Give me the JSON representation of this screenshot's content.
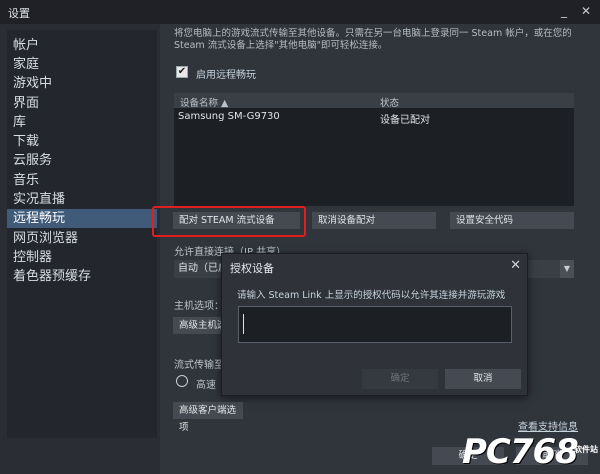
{
  "window": {
    "title": "设置",
    "minimize": "_",
    "close": "✕"
  },
  "sidebar": {
    "items": [
      {
        "label": "帐户"
      },
      {
        "label": "家庭"
      },
      {
        "label": "游戏中"
      },
      {
        "label": "界面"
      },
      {
        "label": "库"
      },
      {
        "label": "下载"
      },
      {
        "label": "云服务"
      },
      {
        "label": "音乐"
      },
      {
        "label": "实况直播"
      },
      {
        "label": "远程畅玩"
      },
      {
        "label": "网页浏览器"
      },
      {
        "label": "控制器"
      },
      {
        "label": "着色器预缓存"
      }
    ],
    "active_index": 9
  },
  "main": {
    "intro": "将您电脑上的游戏流式传输至其他设备。只需在另一台电脑上登录同一 Steam 帐户，或在您的 Steam 流式设备上选择\"其他电脑\"即可轻松连接。",
    "enable_label": "启用远程畅玩",
    "enable_checked": "✔",
    "table": {
      "headers": {
        "name": "设备名称 ▲",
        "status": "状态"
      },
      "rows": [
        {
          "name": "Samsung SM-G9730",
          "status": "设备已配对"
        }
      ]
    },
    "buttons": {
      "pair": "配对 STEAM 流式设备",
      "unpair": "取消设备配对",
      "security": "设置安全代码"
    },
    "direct_label": "允许直接连接（IP 共享）",
    "direct_value": "自动（已启",
    "direct_arrow": "▼",
    "host_label": "主机选项：",
    "host_advanced": "高级主机选",
    "stream_label": "流式传输至",
    "radio_label": "高速",
    "client_advanced": "高级客户端选项",
    "support_link": "查看支持信息",
    "ok": "确定",
    "cancel": "取消"
  },
  "dialog": {
    "title": "授权设备",
    "close": "✕",
    "message": "请输入 Steam Link 上显示的授权代码以允许其连接并游玩游戏",
    "code_value": "",
    "confirm": "确定",
    "cancel": "取消"
  },
  "watermark": {
    "text": "PC768",
    "site": "软件站"
  }
}
